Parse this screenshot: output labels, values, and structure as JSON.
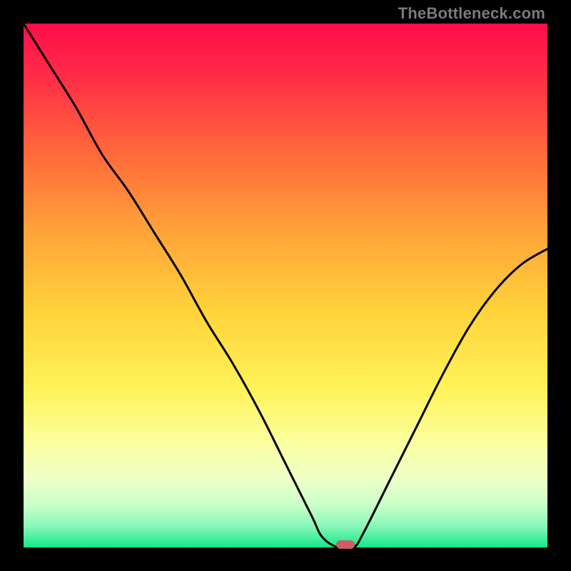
{
  "watermark": "TheBottleneck.com",
  "chart_data": {
    "type": "line",
    "title": "",
    "xlabel": "",
    "ylabel": "",
    "xlim": [
      0,
      100
    ],
    "ylim": [
      0,
      100
    ],
    "x": [
      0,
      5,
      10,
      15,
      20,
      25,
      30,
      35,
      40,
      45,
      50,
      55,
      57,
      60,
      63,
      65,
      70,
      75,
      80,
      85,
      90,
      95,
      100
    ],
    "values": [
      100,
      92,
      84,
      75,
      68,
      60,
      52,
      43,
      35,
      26,
      16,
      6,
      2,
      0,
      0,
      3,
      13,
      23,
      33,
      42,
      49,
      54,
      57
    ],
    "marker": {
      "x": 61.5,
      "y": 0
    },
    "gradient_stops": [
      {
        "offset": 0.0,
        "color": "#ff0d4b"
      },
      {
        "offset": 0.1,
        "color": "#ff2c46"
      },
      {
        "offset": 0.25,
        "color": "#ff6a3a"
      },
      {
        "offset": 0.4,
        "color": "#ffa43a"
      },
      {
        "offset": 0.55,
        "color": "#ffd33a"
      },
      {
        "offset": 0.7,
        "color": "#fff35a"
      },
      {
        "offset": 0.8,
        "color": "#fbffa0"
      },
      {
        "offset": 0.87,
        "color": "#eeffc8"
      },
      {
        "offset": 0.92,
        "color": "#c8ffc8"
      },
      {
        "offset": 0.96,
        "color": "#88f7b8"
      },
      {
        "offset": 1.0,
        "color": "#12e887"
      }
    ]
  }
}
